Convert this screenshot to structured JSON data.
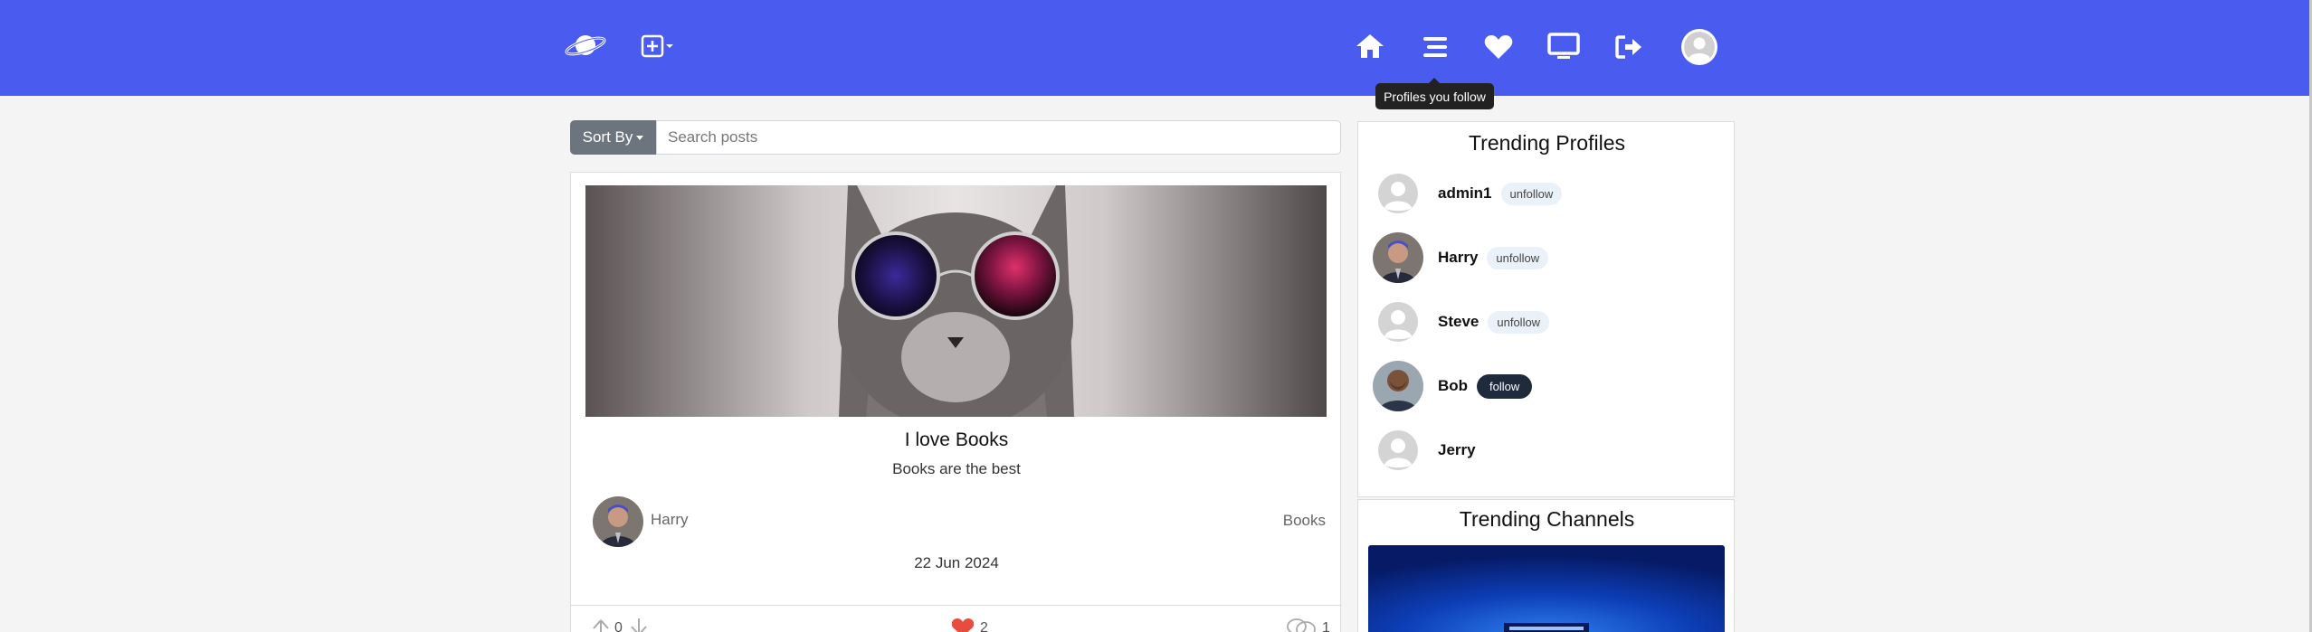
{
  "navbar": {
    "bg_color": "#4a5cf0",
    "logo_icon": "planet-icon",
    "create_icon": "plus-square-icon",
    "icons": [
      "home-icon",
      "list-icon",
      "heart-icon",
      "monitor-icon",
      "sign-out-icon",
      "user-avatar-icon"
    ],
    "tooltip": "Profiles you follow"
  },
  "search": {
    "sort_label": "Sort By",
    "placeholder": "Search posts"
  },
  "post": {
    "title": "I love Books",
    "body": "Books are the best",
    "author": "Harry",
    "channel": "Books",
    "date": "22 Jun 2024",
    "votes": "0",
    "likes": "2",
    "comments": "1",
    "like_color": "#e74c3c"
  },
  "trending_profiles": {
    "title": "Trending Profiles",
    "profiles": [
      {
        "name": "admin1",
        "action": "unfollow"
      },
      {
        "name": "Harry",
        "action": "unfollow"
      },
      {
        "name": "Steve",
        "action": "unfollow"
      },
      {
        "name": "Bob",
        "action": "follow"
      },
      {
        "name": "Jerry",
        "action": ""
      }
    ]
  },
  "trending_channels": {
    "title": "Trending Channels"
  }
}
